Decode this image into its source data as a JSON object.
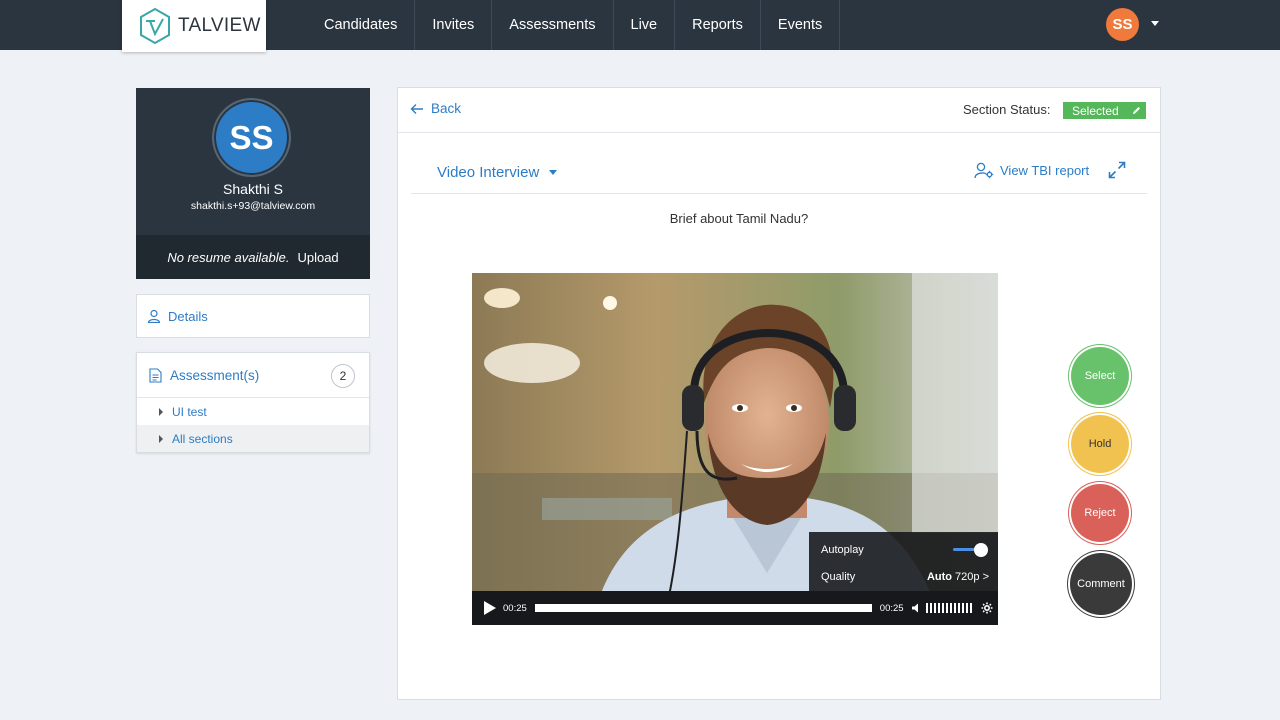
{
  "app": {
    "logo_text": "TALVIEW"
  },
  "nav": {
    "items": [
      {
        "label": "Candidates"
      },
      {
        "label": "Invites"
      },
      {
        "label": "Assessments"
      },
      {
        "label": "Live"
      },
      {
        "label": "Reports"
      },
      {
        "label": "Events"
      }
    ],
    "user_initials": "SS"
  },
  "profile": {
    "initials": "SS",
    "name": "Shakthi S",
    "email": "shakthi.s+93@talview.com",
    "no_resume_text": "No resume available.",
    "upload_label": "Upload"
  },
  "sidebar": {
    "details_label": "Details",
    "assessments_label": "Assessment(s)",
    "assessments_count": "2",
    "assessment_items": [
      {
        "label": "UI test"
      },
      {
        "label": "All sections"
      }
    ]
  },
  "main": {
    "back_label": "Back",
    "section_status_label": "Section Status:",
    "section_status_value": "Selected",
    "section_dropdown": "Video Interview",
    "tbi_report_label": "View TBI report",
    "question": "Brief about Tamil Nadu?"
  },
  "video": {
    "current_time": "00:25",
    "duration": "00:25",
    "progress": 1.0,
    "autoplay_label": "Autoplay",
    "autoplay_on": true,
    "quality_label": "Quality",
    "quality_mode": "Auto",
    "quality_value": "720p >"
  },
  "actions": {
    "select_label": "Select",
    "hold_label": "Hold",
    "reject_label": "Reject",
    "comment_label": "Comment"
  },
  "colors": {
    "nav_bg": "#2b3540",
    "accent": "#2d7cc6",
    "status_green": "#54b75a",
    "avatar_orange": "#ef7a3c"
  }
}
